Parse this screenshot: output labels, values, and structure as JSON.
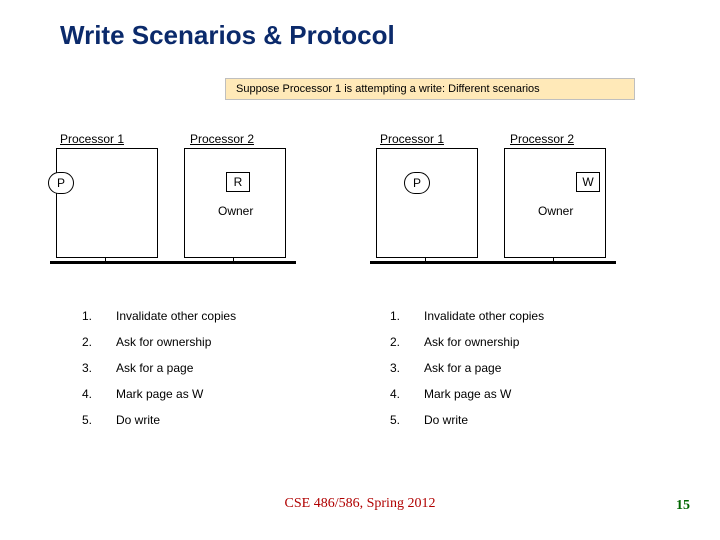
{
  "title": "Write Scenarios & Protocol",
  "banner": "Suppose Processor 1 is attempting a write: Different scenarios",
  "diag": {
    "left": {
      "p1_label": "Processor 1",
      "p2_label": "Processor 2",
      "p1_tag": "P",
      "p2_rw": "R",
      "owner": "Owner"
    },
    "right": {
      "p1_label": "Processor 1",
      "p2_label": "Processor 2",
      "p1_tag": "P",
      "p2_rw": "W",
      "owner": "Owner"
    }
  },
  "steps": {
    "left": [
      {
        "n": "1.",
        "t": "Invalidate other copies"
      },
      {
        "n": "2.",
        "t": "Ask for ownership"
      },
      {
        "n": "3.",
        "t": "Ask for a page"
      },
      {
        "n": "4.",
        "t": "Mark page as W"
      },
      {
        "n": "5.",
        "t": "Do write"
      }
    ],
    "right": [
      {
        "n": "1.",
        "t": "Invalidate other copies"
      },
      {
        "n": "2.",
        "t": "Ask for ownership"
      },
      {
        "n": "3.",
        "t": "Ask for a page"
      },
      {
        "n": "4.",
        "t": "Mark page as W"
      },
      {
        "n": "5.",
        "t": "Do write"
      }
    ]
  },
  "footer": "CSE 486/586, Spring 2012",
  "pagenum": "15"
}
